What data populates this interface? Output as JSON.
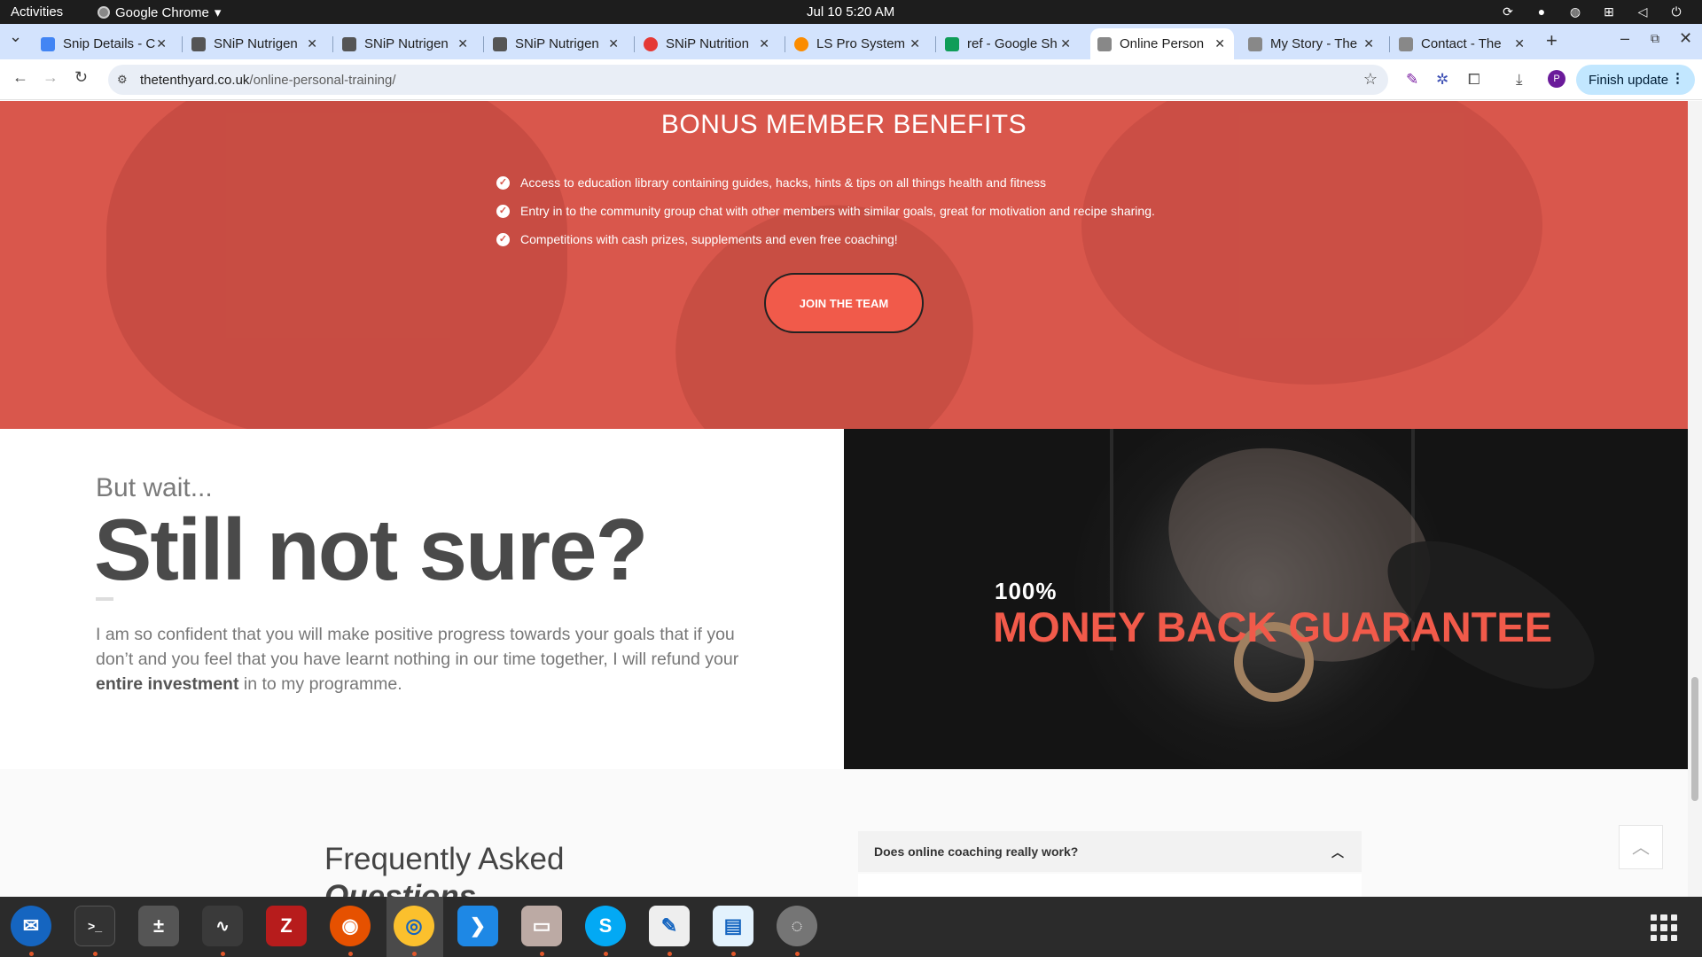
{
  "system_bar": {
    "activities": "Activities",
    "app_name": "Google Chrome",
    "clock": "Jul 10  5:20 AM"
  },
  "tabs": [
    {
      "title": "Snip Details - C",
      "color": "#4285f4"
    },
    {
      "title": "SNiP Nutrigen",
      "color": "#555555"
    },
    {
      "title": "SNiP Nutrigen",
      "color": "#555555"
    },
    {
      "title": "SNiP Nutrigen",
      "color": "#555555"
    },
    {
      "title": "SNiP Nutrition",
      "color": "#e53935"
    },
    {
      "title": "LS Pro System",
      "color": "#fb8c00"
    },
    {
      "title": "ref - Google Sh",
      "color": "#0f9d58"
    },
    {
      "title": "Online Person",
      "color": "#888888",
      "active": true
    },
    {
      "title": "My Story - The",
      "color": "#888888"
    },
    {
      "title": "Contact - The",
      "color": "#888888"
    }
  ],
  "address_bar": {
    "host": "thetenthyard.co.uk",
    "path": "/online-personal-training/",
    "finish_update": "Finish update",
    "profile_initial": "P"
  },
  "page": {
    "bonus": {
      "heading": "BONUS MEMBER BENEFITS",
      "benefits": [
        "Access to education library containing guides, hacks, hints & tips on all things health and fitness",
        "Entry in to the community group chat with other members with similar goals, great for motivation and recipe sharing.",
        "Competitions with cash prizes, supplements and even free coaching!"
      ],
      "cta": "JOIN THE TEAM"
    },
    "not_sure": {
      "pre": "But wait...",
      "heading": "Still not sure?",
      "body_before": "I am so confident that you will make positive progress towards your goals that if you don’t and you feel that you have learnt nothing in our time together, I will refund your ",
      "body_bold": "entire investment",
      "body_after": " in to my programme."
    },
    "guarantee": {
      "percent": "100%",
      "title": "MONEY BACK GUARANTEE"
    },
    "faq": {
      "heading_line1": "Frequently Asked",
      "heading_line2": "Questions",
      "first_question": "Does online coaching really work?"
    }
  },
  "colors": {
    "accent": "#f15a4a",
    "bonus_bg": "#d9574c",
    "tabstrip": "#d3e3fd"
  },
  "dock_items": [
    "thunderbird-icon",
    "terminal-icon",
    "calculator-icon",
    "system-monitor-icon",
    "filezilla-icon",
    "firefox-icon",
    "chrome-icon",
    "vscode-icon",
    "files-icon",
    "skype-icon",
    "text-editor-icon",
    "document-viewer-icon",
    "disk-icon"
  ]
}
